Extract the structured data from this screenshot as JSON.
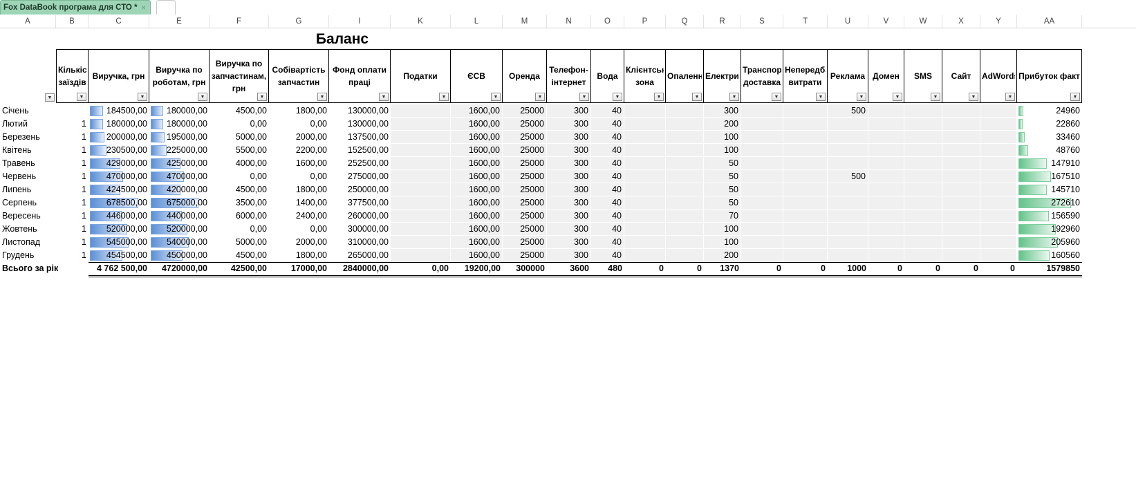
{
  "window": {
    "tab_label": "Fox DataBook програма для СТО *",
    "tab_close": "×"
  },
  "columns": [
    "A",
    "B",
    "C",
    "E",
    "F",
    "G",
    "I",
    "K",
    "L",
    "M",
    "N",
    "O",
    "P",
    "Q",
    "R",
    "S",
    "T",
    "U",
    "V",
    "W",
    "X",
    "Y",
    "AA"
  ],
  "sheet": {
    "title": "Баланс"
  },
  "headers": [
    {
      "text": "",
      "filter": true
    },
    {
      "text": "Кількість заїздів",
      "filter": true
    },
    {
      "text": "Виручка, грн",
      "filter": true
    },
    {
      "text": "Виручка по роботам, грн",
      "filter": true
    },
    {
      "text": "Виручка по запчастинам, грн",
      "filter": true
    },
    {
      "text": "Собівартість запчастин",
      "filter": true
    },
    {
      "text": "Фонд оплати праці",
      "filter": true
    },
    {
      "text": "Податки",
      "filter": true
    },
    {
      "text": "ЄСВ",
      "filter": true
    },
    {
      "text": "Оренда",
      "filter": true
    },
    {
      "text": "Телефон-інтернет",
      "filter": true
    },
    {
      "text": "Вода",
      "filter": true
    },
    {
      "text": "Клієнтська зона",
      "filter": true
    },
    {
      "text": "Опалення",
      "filter": true
    },
    {
      "text": "Електрика",
      "filter": true
    },
    {
      "text": "Транспорт, доставка",
      "filter": true
    },
    {
      "text": "Непередбачувані витрати",
      "filter": true
    },
    {
      "text": "Реклама",
      "filter": true
    },
    {
      "text": "Домен",
      "filter": true
    },
    {
      "text": "SMS",
      "filter": true
    },
    {
      "text": "Сайт",
      "filter": true
    },
    {
      "text": "AdWords",
      "filter": true
    },
    {
      "text": "Прибуток факт",
      "filter": true
    }
  ],
  "rows": [
    {
      "month": "Січень",
      "visits": "",
      "revenue": "184500,00",
      "rev_work": "180000,00",
      "rev_parts": "4500,00",
      "parts_cost": "1800,00",
      "payroll": "130000,00",
      "taxes": "",
      "esv": "1600,00",
      "rent": "25000",
      "phone": "300",
      "water": "40",
      "client": "",
      "heat": "",
      "elec": "300",
      "transport": "",
      "unforeseen": "",
      "ads": "500",
      "domain": "",
      "sms": "",
      "site": "",
      "adwords": "",
      "profit": "24960"
    },
    {
      "month": "Лютий",
      "visits": "1",
      "revenue": "180000,00",
      "rev_work": "180000,00",
      "rev_parts": "0,00",
      "parts_cost": "0,00",
      "payroll": "130000,00",
      "taxes": "",
      "esv": "1600,00",
      "rent": "25000",
      "phone": "300",
      "water": "40",
      "client": "",
      "heat": "",
      "elec": "200",
      "transport": "",
      "unforeseen": "",
      "ads": "",
      "domain": "",
      "sms": "",
      "site": "",
      "adwords": "",
      "profit": "22860"
    },
    {
      "month": "Березень",
      "visits": "1",
      "revenue": "200000,00",
      "rev_work": "195000,00",
      "rev_parts": "5000,00",
      "parts_cost": "2000,00",
      "payroll": "137500,00",
      "taxes": "",
      "esv": "1600,00",
      "rent": "25000",
      "phone": "300",
      "water": "40",
      "client": "",
      "heat": "",
      "elec": "100",
      "transport": "",
      "unforeseen": "",
      "ads": "",
      "domain": "",
      "sms": "",
      "site": "",
      "adwords": "",
      "profit": "33460"
    },
    {
      "month": "Квітень",
      "visits": "1",
      "revenue": "230500,00",
      "rev_work": "225000,00",
      "rev_parts": "5500,00",
      "parts_cost": "2200,00",
      "payroll": "152500,00",
      "taxes": "",
      "esv": "1600,00",
      "rent": "25000",
      "phone": "300",
      "water": "40",
      "client": "",
      "heat": "",
      "elec": "100",
      "transport": "",
      "unforeseen": "",
      "ads": "",
      "domain": "",
      "sms": "",
      "site": "",
      "adwords": "",
      "profit": "48760"
    },
    {
      "month": "Травень",
      "visits": "1",
      "revenue": "429000,00",
      "rev_work": "425000,00",
      "rev_parts": "4000,00",
      "parts_cost": "1600,00",
      "payroll": "252500,00",
      "taxes": "",
      "esv": "1600,00",
      "rent": "25000",
      "phone": "300",
      "water": "40",
      "client": "",
      "heat": "",
      "elec": "50",
      "transport": "",
      "unforeseen": "",
      "ads": "",
      "domain": "",
      "sms": "",
      "site": "",
      "adwords": "",
      "profit": "147910"
    },
    {
      "month": "Червень",
      "visits": "1",
      "revenue": "470000,00",
      "rev_work": "470000,00",
      "rev_parts": "0,00",
      "parts_cost": "0,00",
      "payroll": "275000,00",
      "taxes": "",
      "esv": "1600,00",
      "rent": "25000",
      "phone": "300",
      "water": "40",
      "client": "",
      "heat": "",
      "elec": "50",
      "transport": "",
      "unforeseen": "",
      "ads": "500",
      "domain": "",
      "sms": "",
      "site": "",
      "adwords": "",
      "profit": "167510"
    },
    {
      "month": "Липень",
      "visits": "1",
      "revenue": "424500,00",
      "rev_work": "420000,00",
      "rev_parts": "4500,00",
      "parts_cost": "1800,00",
      "payroll": "250000,00",
      "taxes": "",
      "esv": "1600,00",
      "rent": "25000",
      "phone": "300",
      "water": "40",
      "client": "",
      "heat": "",
      "elec": "50",
      "transport": "",
      "unforeseen": "",
      "ads": "",
      "domain": "",
      "sms": "",
      "site": "",
      "adwords": "",
      "profit": "145710"
    },
    {
      "month": "Серпень",
      "visits": "1",
      "revenue": "678500,00",
      "rev_work": "675000,00",
      "rev_parts": "3500,00",
      "parts_cost": "1400,00",
      "payroll": "377500,00",
      "taxes": "",
      "esv": "1600,00",
      "rent": "25000",
      "phone": "300",
      "water": "40",
      "client": "",
      "heat": "",
      "elec": "50",
      "transport": "",
      "unforeseen": "",
      "ads": "",
      "domain": "",
      "sms": "",
      "site": "",
      "adwords": "",
      "profit": "272610"
    },
    {
      "month": "Вересень",
      "visits": "1",
      "revenue": "446000,00",
      "rev_work": "440000,00",
      "rev_parts": "6000,00",
      "parts_cost": "2400,00",
      "payroll": "260000,00",
      "taxes": "",
      "esv": "1600,00",
      "rent": "25000",
      "phone": "300",
      "water": "40",
      "client": "",
      "heat": "",
      "elec": "70",
      "transport": "",
      "unforeseen": "",
      "ads": "",
      "domain": "",
      "sms": "",
      "site": "",
      "adwords": "",
      "profit": "156590"
    },
    {
      "month": "Жовтень",
      "visits": "1",
      "revenue": "520000,00",
      "rev_work": "520000,00",
      "rev_parts": "0,00",
      "parts_cost": "0,00",
      "payroll": "300000,00",
      "taxes": "",
      "esv": "1600,00",
      "rent": "25000",
      "phone": "300",
      "water": "40",
      "client": "",
      "heat": "",
      "elec": "100",
      "transport": "",
      "unforeseen": "",
      "ads": "",
      "domain": "",
      "sms": "",
      "site": "",
      "adwords": "",
      "profit": "192960"
    },
    {
      "month": "Листопад",
      "visits": "1",
      "revenue": "545000,00",
      "rev_work": "540000,00",
      "rev_parts": "5000,00",
      "parts_cost": "2000,00",
      "payroll": "310000,00",
      "taxes": "",
      "esv": "1600,00",
      "rent": "25000",
      "phone": "300",
      "water": "40",
      "client": "",
      "heat": "",
      "elec": "100",
      "transport": "",
      "unforeseen": "",
      "ads": "",
      "domain": "",
      "sms": "",
      "site": "",
      "adwords": "",
      "profit": "205960"
    },
    {
      "month": "Грудень",
      "visits": "1",
      "revenue": "454500,00",
      "rev_work": "450000,00",
      "rev_parts": "4500,00",
      "parts_cost": "1800,00",
      "payroll": "265000,00",
      "taxes": "",
      "esv": "1600,00",
      "rent": "25000",
      "phone": "300",
      "water": "40",
      "client": "",
      "heat": "",
      "elec": "200",
      "transport": "",
      "unforeseen": "",
      "ads": "",
      "domain": "",
      "sms": "",
      "site": "",
      "adwords": "",
      "profit": "160560"
    }
  ],
  "totals": {
    "month": "Всього за рік",
    "visits": "",
    "revenue": "4 762 500,00",
    "rev_work": "4720000,00",
    "rev_parts": "42500,00",
    "parts_cost": "17000,00",
    "payroll": "2840000,00",
    "taxes": "0,00",
    "esv": "19200,00",
    "rent": "300000",
    "phone": "3600",
    "water": "480",
    "client": "0",
    "heat": "0",
    "elec": "1370",
    "transport": "0",
    "unforeseen": "0",
    "ads": "1000",
    "domain": "0",
    "sms": "0",
    "site": "0",
    "adwords": "0",
    "profit": "1579850"
  },
  "databar_colors": {
    "revenue": "#5b8fd6",
    "profit": "#63c38a"
  },
  "icons": {
    "filter": "filter-dropdown-icon",
    "close": "close-icon"
  }
}
